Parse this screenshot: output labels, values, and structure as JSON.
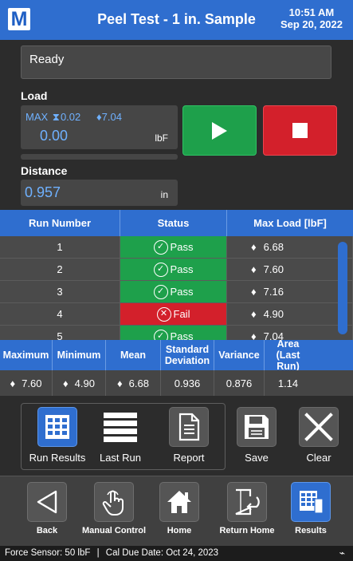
{
  "header": {
    "logo": "M",
    "title": "Peel Test - 1 in. Sample",
    "time": "10:51 AM",
    "date": "Sep 20, 2022",
    "color": "#2f6ecf"
  },
  "status": {
    "text": "Ready"
  },
  "load": {
    "label": "Load",
    "max_label": "MAX",
    "max_value": "0.02",
    "track_value": "7.04",
    "value": "0.00",
    "unit": "lbF"
  },
  "distance": {
    "label": "Distance",
    "value": "0.957",
    "unit": "in"
  },
  "controls": {
    "start_icon": "play-icon",
    "stop_icon": "stop-icon",
    "start_color": "#1ea04b",
    "stop_color": "#d3202b"
  },
  "runs": {
    "headers": [
      "Run Number",
      "Status",
      "Max Load [lbF]"
    ],
    "rows": [
      {
        "run": "1",
        "status": "Pass",
        "max_load": "6.68"
      },
      {
        "run": "2",
        "status": "Pass",
        "max_load": "7.60"
      },
      {
        "run": "3",
        "status": "Pass",
        "max_load": "7.16"
      },
      {
        "run": "4",
        "status": "Fail",
        "max_load": "4.90"
      },
      {
        "run": "5",
        "status": "Pass",
        "max_load": "7.04"
      }
    ]
  },
  "stats": {
    "headers": [
      "Maximum",
      "Minimum",
      "Mean",
      "Standard Deviation",
      "Variance",
      "Area (Last Run)"
    ],
    "values": [
      "7.60",
      "4.90",
      "6.68",
      "0.936",
      "0.876",
      "1.14"
    ]
  },
  "tools": {
    "run_results": "Run Results",
    "last_run": "Last Run",
    "report": "Report",
    "save": "Save",
    "clear": "Clear"
  },
  "nav": {
    "back": "Back",
    "manual_control": "Manual Control",
    "home": "Home",
    "return_home": "Return Home",
    "results": "Results"
  },
  "footer": {
    "sensor": "Force Sensor: 50 lbF",
    "separator": "|",
    "cal_due": "Cal Due Date: Oct 24, 2023"
  }
}
